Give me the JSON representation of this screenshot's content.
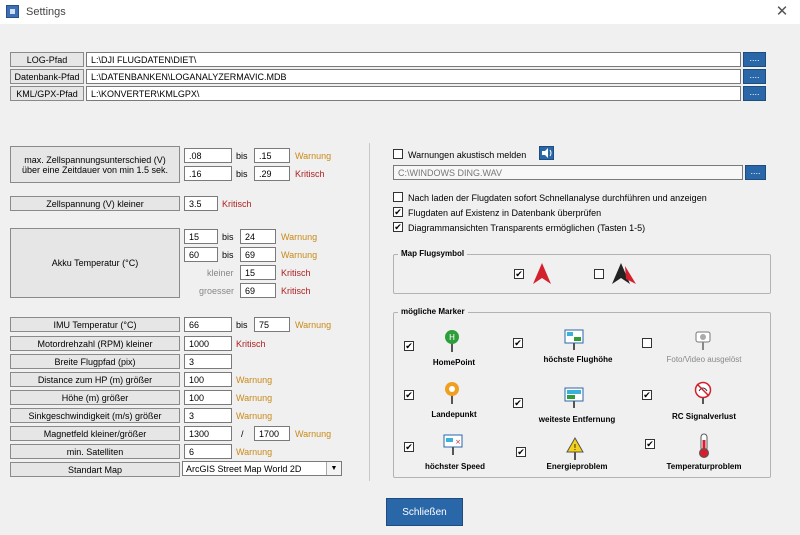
{
  "window": {
    "title": "Settings",
    "close_glyph": "✕"
  },
  "paths": [
    {
      "label": "LOG-Pfad",
      "value": "L:\\DJI FLUGDATEN\\DIET\\",
      "browse": "...."
    },
    {
      "label": "Datenbank-Pfad",
      "value": "L:\\DATENBANKEN\\LOGANALYZERMAVIC.MDB",
      "browse": "...."
    },
    {
      "label": "KML/GPX-Pfad",
      "value": "L:\\KONVERTER\\KMLGPX\\",
      "browse": "...."
    }
  ],
  "common": {
    "bis": "bis",
    "warnung": "Warnung",
    "kritisch": "Kritisch",
    "slash": "/"
  },
  "cell_diff": {
    "label_line1": "max. Zellspannungsunterschied (V)",
    "label_line2": "über eine Zeitdauer von min 1.5 sek.",
    "warn_from": ".08",
    "warn_to": ".15",
    "crit_from": ".16",
    "crit_to": ".29"
  },
  "cell_voltage": {
    "label": "Zellspannung (V) kleiner",
    "value": "3.5"
  },
  "akku": {
    "label": "Akku Temperatur (°C)",
    "r1_from": "15",
    "r1_to": "24",
    "r2_from": "60",
    "r2_to": "69",
    "kleiner_label": "kleiner",
    "kleiner_value": "15",
    "groesser_label": "groesser",
    "groesser_value": "69"
  },
  "imu": {
    "label": "IMU Temperatur (°C)",
    "from": "66",
    "to": "75"
  },
  "motor": {
    "label": "Motordrehzahl (RPM) kleiner",
    "value": "1000"
  },
  "breite": {
    "label": "Breite Flugpfad (pix)",
    "value": "3"
  },
  "distance": {
    "label": "Distance zum HP (m) größer",
    "value": "100"
  },
  "hoehe": {
    "label": "Höhe (m) größer",
    "value": "100"
  },
  "sink": {
    "label": "Sinkgeschwindigkeit (m/s) größer",
    "value": "3"
  },
  "magnet": {
    "label": "Magnetfeld  kleiner/größer",
    "from": "1300",
    "to": "1700"
  },
  "sats": {
    "label": "min. Satelliten",
    "value": "6"
  },
  "map": {
    "label": "Standart Map",
    "selected": "ArcGIS Street Map World 2D"
  },
  "sound": {
    "label": "Warnungen akustisch melden",
    "checked": "",
    "file": "C:\\WINDOWS DING.WAV",
    "browse": "...."
  },
  "options": [
    {
      "label": "Nach laden der Flugdaten sofort Schnellanalyse durchführen und anzeigen",
      "checked": ""
    },
    {
      "label": "Flugdaten auf Existenz in Datenbank überprüfen",
      "checked": "✔"
    },
    {
      "label": "Diagrammansichten Transparents ermöglichen (Tasten 1-5)",
      "checked": "✔"
    }
  ],
  "flugsymbol": {
    "title": "Map Flugsymbol",
    "opt1_checked": "✔",
    "opt2_checked": ""
  },
  "marker": {
    "title": "mögliche Marker",
    "items": [
      {
        "label": "HomePoint",
        "checked": "✔"
      },
      {
        "label": "höchste Flughöhe",
        "checked": "✔"
      },
      {
        "label": "Foto/Video ausgelöst",
        "checked": ""
      },
      {
        "label": "Landepunkt",
        "checked": "✔"
      },
      {
        "label": "weiteste Entfernung",
        "checked": "✔"
      },
      {
        "label": "RC Signalverlust",
        "checked": "✔"
      },
      {
        "label": "höchster Speed",
        "checked": "✔"
      },
      {
        "label": "Energieproblem",
        "checked": "✔"
      },
      {
        "label": "Temperaturproblem",
        "checked": "✔"
      }
    ]
  },
  "close_button": "Schließen",
  "colors": {
    "accent": "#2a67a8",
    "warning": "#c98a18",
    "critical": "#b02020"
  }
}
